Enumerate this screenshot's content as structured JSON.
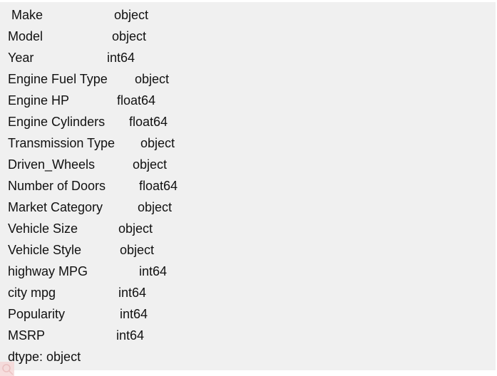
{
  "output": {
    "rows": [
      {
        "name": " Make",
        "dtype": "object"
      },
      {
        "name": "Model",
        "dtype": "object"
      },
      {
        "name": "Year",
        "dtype": "int64"
      },
      {
        "name": "Engine Fuel Type",
        "dtype": "object"
      },
      {
        "name": "Engine HP",
        "dtype": "float64"
      },
      {
        "name": "Engine Cylinders",
        "dtype": "float64"
      },
      {
        "name": "Transmission Type",
        "dtype": "object"
      },
      {
        "name": "Driven_Wheels",
        "dtype": "object"
      },
      {
        "name": "Number of Doors",
        "dtype": "float64"
      },
      {
        "name": "Market Category",
        "dtype": "object"
      },
      {
        "name": "Vehicle Size",
        "dtype": "object"
      },
      {
        "name": "Vehicle Style",
        "dtype": "object"
      },
      {
        "name": "highway MPG",
        "dtype": "int64"
      },
      {
        "name": "city mpg",
        "dtype": "int64"
      },
      {
        "name": "Popularity",
        "dtype": "int64"
      },
      {
        "name": "MSRP",
        "dtype": "int64"
      }
    ],
    "footer": "dtype: object"
  },
  "icons": {
    "watermark": "search-icon"
  }
}
